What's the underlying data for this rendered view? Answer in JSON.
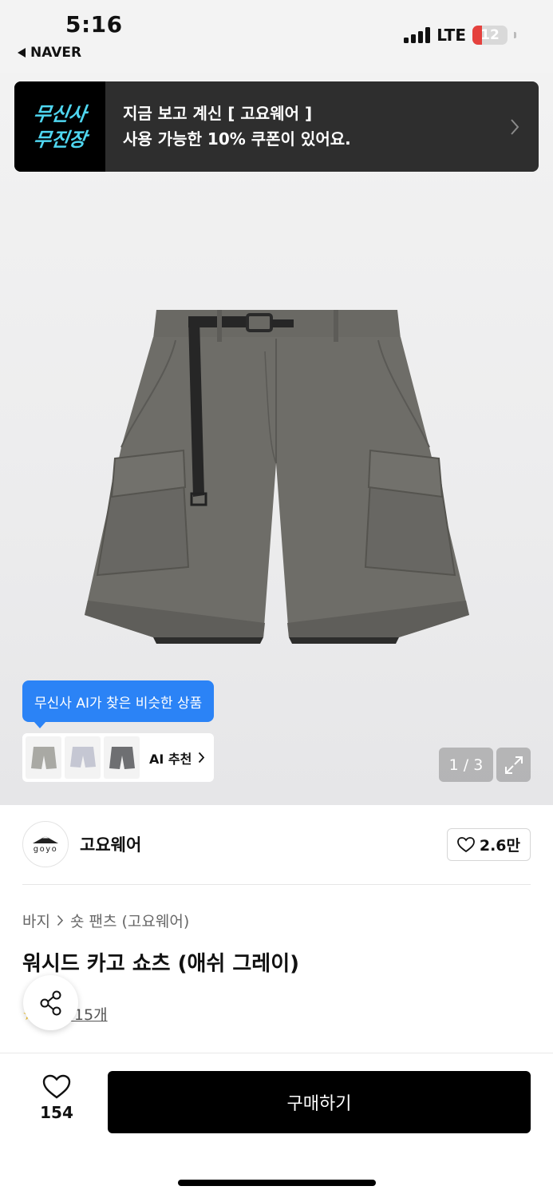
{
  "status_bar": {
    "time": "5:16",
    "back_app": "NAVER",
    "network": "LTE",
    "battery": "12",
    "battery_color": "#e5413d"
  },
  "promo": {
    "logo_line1": "무신사",
    "logo_line2": "무진장",
    "line1": "지금 보고 계신 [ 고요웨어 ]",
    "line2": "사용 가능한 10% 쿠폰이 있어요.",
    "logo_color": "#4fd6f0"
  },
  "gallery": {
    "image_icon": "cargo-shorts-image",
    "ai_tooltip": "무신사 AI가 찾은 비슷한 상품",
    "ai_recommend_label": "AI 추천",
    "page_indicator": "1 / 3",
    "thumbnails": [
      {
        "color": "#a9a9a4"
      },
      {
        "color": "#c5c7d3"
      },
      {
        "color": "#6e6f72"
      }
    ]
  },
  "brand": {
    "logo_text": "goyo",
    "name": "고요웨어",
    "likes": "2.6만"
  },
  "product": {
    "breadcrumb": [
      "바지",
      "숏 팬츠 (고요웨어)"
    ],
    "title": "워시드 카고 쇼츠 (애쉬 그레이)",
    "review_text": "후기 15개"
  },
  "bottom": {
    "wish_count": "154",
    "buy_label": "구매하기"
  },
  "colors": {
    "accent_blue": "#2b83f6",
    "buy_button": "#000000"
  }
}
